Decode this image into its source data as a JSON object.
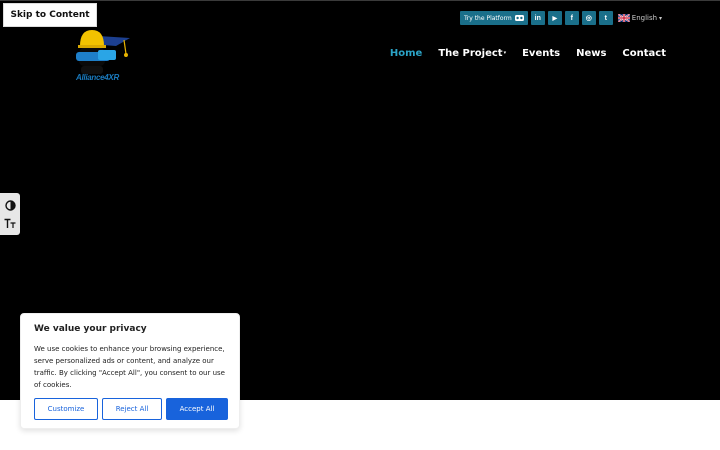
{
  "skip_link": "Skip to Content",
  "logo": {
    "text": "Alliance4XR"
  },
  "topbar": {
    "try_platform": "Try the Platform",
    "socials": [
      {
        "name": "linkedin",
        "glyph": "in"
      },
      {
        "name": "youtube",
        "glyph": "▶"
      },
      {
        "name": "facebook",
        "glyph": "f"
      },
      {
        "name": "instagram",
        "glyph": "◎"
      },
      {
        "name": "twitter",
        "glyph": "t"
      }
    ],
    "language": "English",
    "language_caret": "▾"
  },
  "nav": {
    "items": [
      {
        "label": "Home",
        "active": true
      },
      {
        "label": "The Project",
        "has_dropdown": true,
        "caret": "▾"
      },
      {
        "label": "Events"
      },
      {
        "label": "News"
      },
      {
        "label": "Contact"
      }
    ]
  },
  "accessibility": {
    "contrast_icon": "◐",
    "font_size_icon": "tT"
  },
  "cookie": {
    "title": "We value your privacy",
    "body": "We use cookies to enhance your browsing experience, serve personalized ads or content, and analyze our traffic. By clicking \"Accept All\", you consent to our use of cookies.",
    "customize": "Customize",
    "reject": "Reject All",
    "accept": "Accept All"
  },
  "colors": {
    "hero_bg": "#000000",
    "accent": "#1a6f8a",
    "nav_active": "#2ba3c6",
    "cookie_primary": "#1863dc"
  }
}
